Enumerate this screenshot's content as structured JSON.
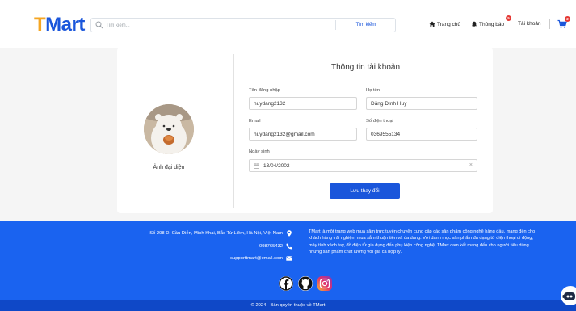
{
  "header": {
    "logo_t": "T",
    "logo_rest": "Mart",
    "search_placeholder": "Tìm kiếm...",
    "search_button": "Tìm kiếm",
    "nav_home": "Trang chủ",
    "nav_notify": "Thông báo",
    "notify_badge": "5",
    "nav_account": "Tài khoản",
    "cart_badge": "2"
  },
  "profile": {
    "title": "Thông tin tài khoản",
    "avatar_label": "Ảnh đại diện",
    "username_label": "Tên đăng nhập",
    "username_value": "huydang2132",
    "fullname_label": "Họ tên",
    "fullname_value": "Đặng Đình Huy",
    "email_label": "Email",
    "email_value": "huydang2132@gmail.com",
    "phone_label": "Số điện thoại",
    "phone_value": "0369555134",
    "dob_label": "Ngày sinh",
    "dob_value": "13/04/2002",
    "save_button": "Lưu thay đổi"
  },
  "footer": {
    "address": "Số 298 Đ. Cầu Diễn, Minh Khai, Bắc Từ Liêm, Hà Nội, Việt Nam",
    "phone": "098765432",
    "email": "supporttmart@email.com",
    "about": "TMart là một trang web mua sắm trực tuyến chuyên cung cấp các sản phẩm công nghệ hàng đầu, mang đến cho khách hàng trải nghiệm mua sắm thuận tiện và đa dạng. Với danh mục sản phẩm đa dạng từ điện thoại di động, máy tính xách tay, đồ điện tử gia dụng đến phụ kiện công nghệ, TMart cam kết mang đến cho người tiêu dùng những sản phẩm chất lượng với giá cả hợp lý.",
    "copyright": "© 2024 - Bản quyền thuộc về TMart"
  },
  "icons": {
    "search": "search-icon",
    "home": "home-icon",
    "bell": "bell-icon",
    "cart": "cart-icon",
    "location": "location-icon",
    "phone": "phone-icon",
    "mail": "mail-icon",
    "calendar": "calendar-icon",
    "facebook": "facebook-icon",
    "github": "github-icon",
    "instagram": "instagram-icon"
  },
  "colors": {
    "brand_blue": "#1a56db",
    "brand_orange": "#f5a623",
    "footer_blue": "#1a63f0",
    "badge_red": "#e53935"
  }
}
